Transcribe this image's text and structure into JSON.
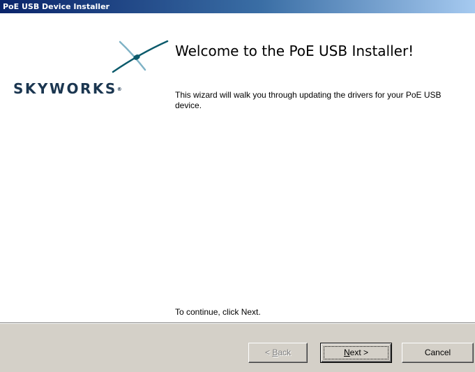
{
  "window": {
    "title": "PoE USB Device Installer"
  },
  "brand": {
    "logo_text": "SKYWORKS",
    "logo_mark": "®"
  },
  "welcome": {
    "title": "Welcome to the PoE USB Installer!",
    "body": "This wizard will walk you through updating the drivers for your PoE USB device.",
    "continue_text": "To continue, click Next."
  },
  "buttons": {
    "back": {
      "prefix": "< ",
      "accel": "B",
      "rest": "ack",
      "enabled": false
    },
    "next": {
      "accel": "N",
      "rest": "ext >",
      "enabled": true
    },
    "cancel": {
      "label": "Cancel"
    }
  },
  "colors": {
    "titlebar_start": "#0a246a",
    "titlebar_end": "#a6caf0",
    "logo_text": "#1b3650",
    "logo_mark_dark": "#0b5a6b",
    "logo_mark_light": "#7fb3c6",
    "dialog_face": "#d4d0c8"
  },
  "icons": {
    "logo": "skyworks-x-mark"
  }
}
